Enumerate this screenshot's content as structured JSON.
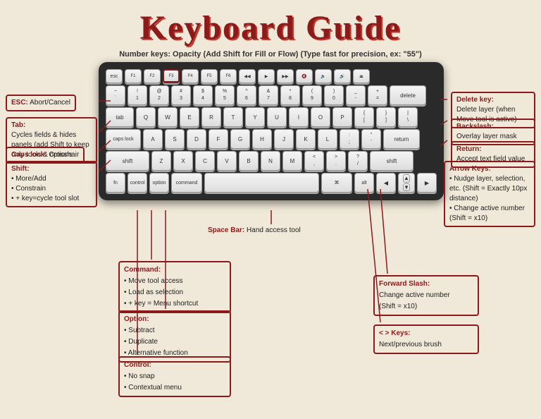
{
  "title": "Keyboard Guide",
  "number_keys_note": "Number keys: Opacity (Add Shift for Fill or Flow) (Type fast for precision, ex: \"55\")",
  "annotations": {
    "esc": {
      "label": "ESC:",
      "desc": "Abort/Cancel"
    },
    "tab": {
      "label": "Tab:",
      "desc": "Cycles fields & hides panels (add Shift to keep only tools & options"
    },
    "caps": {
      "label": "Caps lock:",
      "desc": "Crosshair"
    },
    "shift": {
      "label": "Shift:",
      "items": [
        "• More/Add",
        "• Constrain",
        "• + key=cycle tool slot"
      ]
    },
    "delete": {
      "label": "Delete key:",
      "desc": "Delete layer (when Move tool is active)"
    },
    "backslash": {
      "label": "Backslash:",
      "desc": "Overlay layer mask"
    },
    "return": {
      "label": "Return:",
      "desc": "Accept text field value"
    },
    "arrow": {
      "label": "Arrow Keys:",
      "items": [
        "• Nudge layer, selection, etc. (Shift = Exactly 10px distance)",
        "• Change active number (Shift = x10)"
      ]
    },
    "command": {
      "label": "Command:",
      "items": [
        "• Move tool access",
        "• Load as selection",
        "• + key = Menu shortcut"
      ]
    },
    "option": {
      "label": "Option:",
      "items": [
        "• Subtract",
        "• Duplicate",
        "• Alternative function"
      ]
    },
    "control": {
      "label": "Control:",
      "items": [
        "• No snap",
        "• Contextual menu"
      ]
    },
    "forward_slash": {
      "label": "Forward Slash:",
      "items": [
        "Change active number",
        "(Shift = x10)"
      ]
    },
    "angle_keys": {
      "label": "< > Keys:",
      "desc": "Next/previous brush"
    },
    "space": {
      "label": "Space Bar:",
      "desc": "Hand access tool"
    }
  }
}
